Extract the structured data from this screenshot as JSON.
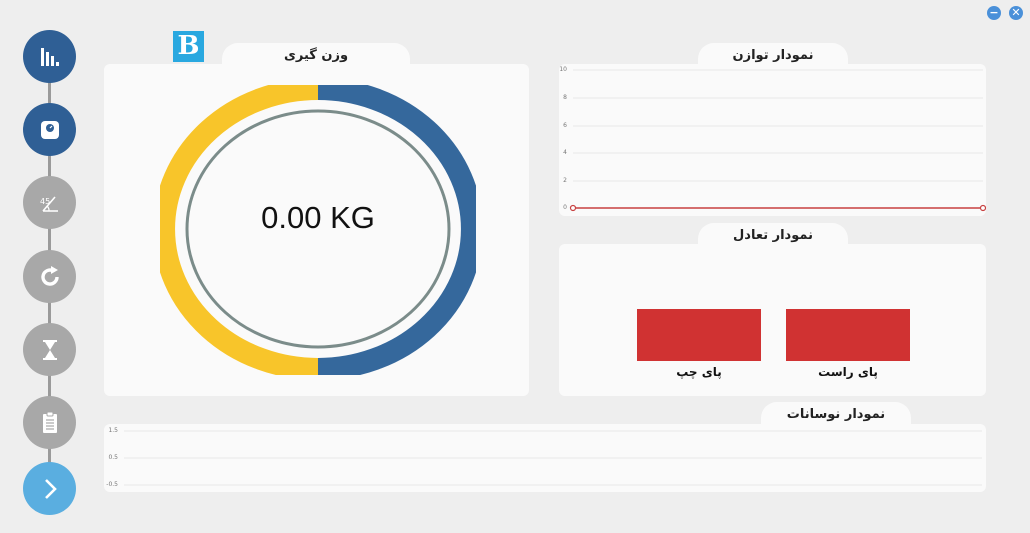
{
  "window": {
    "minimize_icon": "minimize-icon",
    "close_icon": "close-icon",
    "minimize_glyph": "−",
    "close_glyph": "✕"
  },
  "logo": {
    "text": "B",
    "color": "#29a8e0"
  },
  "nav": {
    "items": [
      {
        "name": "bar-chart-icon",
        "state": "active"
      },
      {
        "name": "scale-icon",
        "state": "active"
      },
      {
        "name": "angle-45-icon",
        "state": "inactive"
      },
      {
        "name": "rotate-icon",
        "state": "inactive"
      },
      {
        "name": "hourglass-icon",
        "state": "inactive"
      },
      {
        "name": "clipboard-icon",
        "state": "inactive"
      },
      {
        "name": "next-arrow-icon",
        "state": "next"
      }
    ],
    "colors": {
      "active": "#2f5f95",
      "inactive": "#a8a8a8",
      "next": "#5aaee0"
    }
  },
  "weighing": {
    "title": "وزن گیری",
    "value": "0.00 KG",
    "left_fraction": 0.5,
    "colors": {
      "left": "#f8c52a",
      "right": "#35689c"
    }
  },
  "balance_chart": {
    "title": "نمودار توازن",
    "y_ticks": [
      "10",
      "8",
      "6",
      "4",
      "2",
      "0"
    ],
    "line_color": "#c74040"
  },
  "equilibrium_chart": {
    "title": "نمودار تعادل",
    "left_leg_label": "پای چپ",
    "right_leg_label": "پای راست",
    "bar_color": "#d03232"
  },
  "oscillation_chart": {
    "title": "نمودار نوسانات",
    "y_ticks": [
      "1.5",
      "0.5",
      "-0.5"
    ]
  }
}
